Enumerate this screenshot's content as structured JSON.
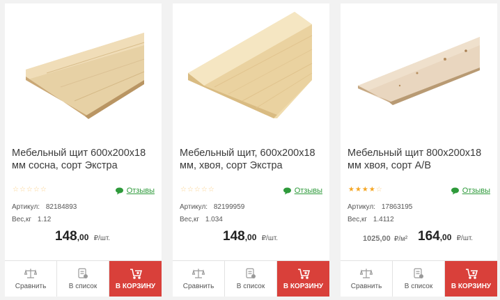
{
  "products": [
    {
      "title": "Мебельный щит 600x200x18 мм сосна, сорт Экстра",
      "rating": 0,
      "reviews_label": "Отзывы",
      "sku_label": "Артикул:",
      "sku": "82184893",
      "weight_label": "Вес,кг",
      "weight": "1.12",
      "price_main": "148",
      "price_cents": ",00",
      "price_unit": "₽/шт.",
      "compare_label": "Сравнить",
      "list_label": "В список",
      "cart_label": "В КОРЗИНУ"
    },
    {
      "title": "Мебельный щит, 600x200x18 мм, хвоя, сорт Экстра",
      "rating": 0,
      "reviews_label": "Отзывы",
      "sku_label": "Артикул:",
      "sku": "82199959",
      "weight_label": "Вес,кг",
      "weight": "1.034",
      "price_main": "148",
      "price_cents": ",00",
      "price_unit": "₽/шт.",
      "compare_label": "Сравнить",
      "list_label": "В список",
      "cart_label": "В КОРЗИНУ"
    },
    {
      "title": "Мебельный щит 800x200x18 мм хвоя, сорт А/В",
      "rating": 4,
      "reviews_label": "Отзывы",
      "sku_label": "Артикул:",
      "sku": "17863195",
      "weight_label": "Вес,кг",
      "weight": "1.4112",
      "alt_price": "1025,00",
      "alt_price_unit": "₽/м²",
      "price_main": "164",
      "price_cents": ",00",
      "price_unit": "₽/шт.",
      "compare_label": "Сравнить",
      "list_label": "В список",
      "cart_label": "В КОРЗИНУ"
    }
  ],
  "colors": {
    "cart_button": "#d9403a",
    "reviews_link": "#2e9a3b",
    "star": "#f5a623"
  }
}
